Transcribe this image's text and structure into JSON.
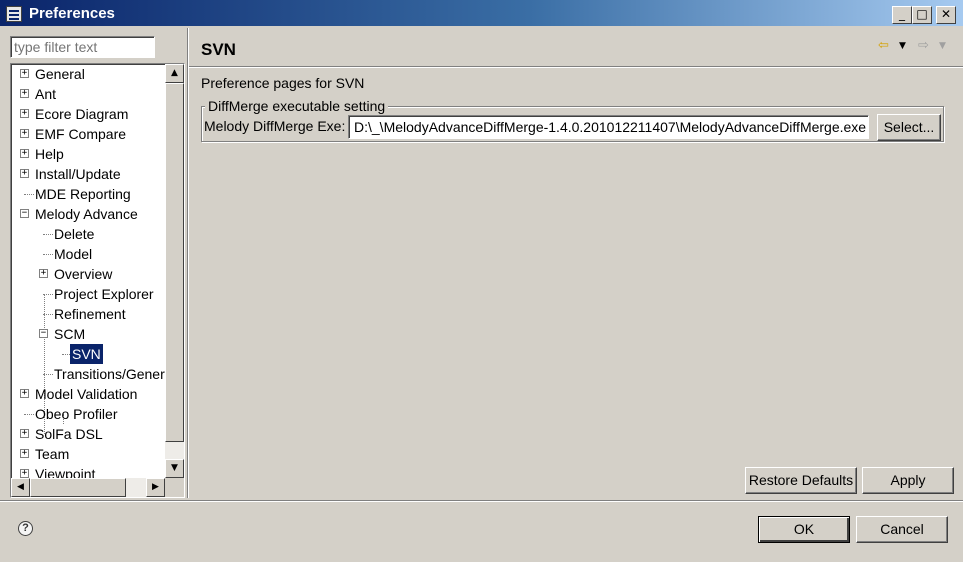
{
  "window": {
    "title": "Preferences",
    "controls": {
      "minimize": "_",
      "maximize": "□",
      "close": "✕"
    }
  },
  "filter": {
    "placeholder": "type filter text"
  },
  "tree": {
    "items": [
      {
        "label": "General",
        "level": 0,
        "expander": "+"
      },
      {
        "label": "Ant",
        "level": 0,
        "expander": "+"
      },
      {
        "label": "Ecore Diagram",
        "level": 0,
        "expander": "+"
      },
      {
        "label": "EMF Compare",
        "level": 0,
        "expander": "+"
      },
      {
        "label": "Help",
        "level": 0,
        "expander": "+"
      },
      {
        "label": "Install/Update",
        "level": 0,
        "expander": "+"
      },
      {
        "label": "MDE Reporting",
        "level": 0,
        "expander": ""
      },
      {
        "label": "Melody Advance",
        "level": 0,
        "expander": "−"
      },
      {
        "label": "Delete",
        "level": 1,
        "expander": ""
      },
      {
        "label": "Model",
        "level": 1,
        "expander": ""
      },
      {
        "label": "Overview",
        "level": 1,
        "expander": "+"
      },
      {
        "label": "Project Explorer",
        "level": 1,
        "expander": ""
      },
      {
        "label": "Refinement",
        "level": 1,
        "expander": ""
      },
      {
        "label": "SCM",
        "level": 1,
        "expander": "−"
      },
      {
        "label": "SVN",
        "level": 2,
        "expander": "",
        "selected": true
      },
      {
        "label": "Transitions/Generation",
        "level": 1,
        "expander": ""
      },
      {
        "label": "Model Validation",
        "level": 0,
        "expander": "+"
      },
      {
        "label": "Obeo Profiler",
        "level": 0,
        "expander": ""
      },
      {
        "label": "SolFa DSL",
        "level": 0,
        "expander": "+"
      },
      {
        "label": "Team",
        "level": 0,
        "expander": "+"
      },
      {
        "label": "Viewpoint",
        "level": 0,
        "expander": "+"
      }
    ],
    "scroll": {
      "up": "▲",
      "down": "▼",
      "left": "◀",
      "right": "▶"
    }
  },
  "page": {
    "title": "SVN",
    "description": "Preference pages for SVN",
    "nav": {
      "back": "⇦",
      "back_menu": "▼",
      "forward": "⇨",
      "forward_menu": "▼"
    },
    "group": {
      "legend": "DiffMerge executable setting",
      "exe_label": "Melody DiffMerge Exe:",
      "exe_value": "D:\\_\\MelodyAdvanceDiffMerge-1.4.0.201012211407\\MelodyAdvanceDiffMerge.exe",
      "select_label": "Select..."
    },
    "restore_label": "Restore Defaults",
    "apply_label": "Apply"
  },
  "footer": {
    "help": "?",
    "ok_label": "OK",
    "cancel_label": "Cancel"
  },
  "colors": {
    "selection": "#0a246a",
    "dialog_bg": "#d4d0c8",
    "title_gradient_start": "#0a246a",
    "title_gradient_end": "#a6caf0"
  }
}
